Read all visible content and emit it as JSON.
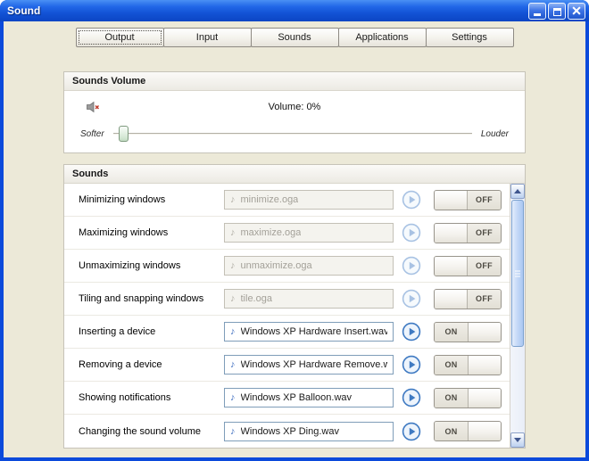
{
  "window": {
    "title": "Sound"
  },
  "tabs": [
    {
      "label": "Output",
      "focused": true
    },
    {
      "label": "Input",
      "focused": false
    },
    {
      "label": "Sounds",
      "focused": false
    },
    {
      "label": "Applications",
      "focused": false
    },
    {
      "label": "Settings",
      "focused": false
    }
  ],
  "sounds_volume": {
    "header": "Sounds Volume",
    "volume_label": "Volume: 0%",
    "volume_percent": 0,
    "softer_label": "Softer",
    "louder_label": "Louder"
  },
  "sounds": {
    "header": "Sounds",
    "on_label": "ON",
    "off_label": "OFF",
    "note_glyph": "♪",
    "rows": [
      {
        "label": "Minimizing windows",
        "file": "minimize.oga",
        "enabled": false
      },
      {
        "label": "Maximizing windows",
        "file": "maximize.oga",
        "enabled": false
      },
      {
        "label": "Unmaximizing windows",
        "file": "unmaximize.oga",
        "enabled": false
      },
      {
        "label": "Tiling and snapping windows",
        "file": "tile.oga",
        "enabled": false
      },
      {
        "label": "Inserting a device",
        "file": "Windows XP Hardware Insert.wav",
        "enabled": true
      },
      {
        "label": "Removing a device",
        "file": "Windows XP Hardware Remove.wav",
        "enabled": true
      },
      {
        "label": "Showing notifications",
        "file": "Windows XP Balloon.wav",
        "enabled": true
      },
      {
        "label": "Changing the sound volume",
        "file": "Windows XP Ding.wav",
        "enabled": true
      }
    ]
  },
  "colors": {
    "titlebar_blue": "#1353d6",
    "accent_blue": "#3f7ac2",
    "window_bg": "#ece9d8"
  }
}
